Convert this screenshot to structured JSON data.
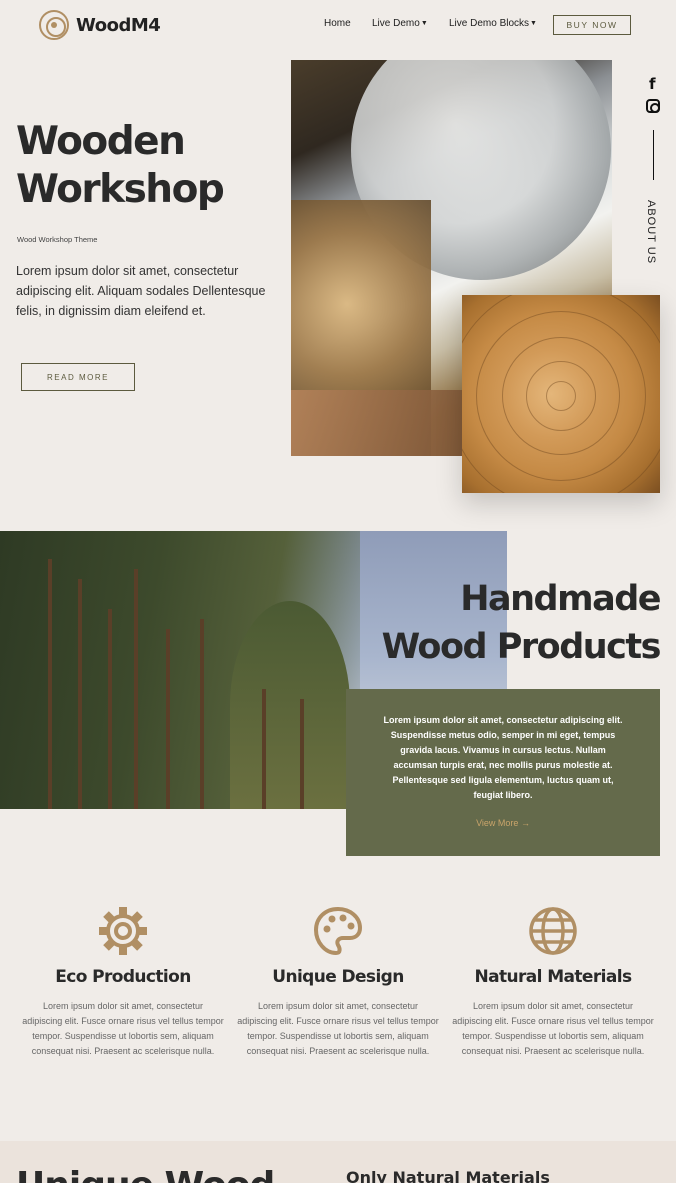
{
  "nav": {
    "logo_text": "WoodM4",
    "home": "Home",
    "live_demo": "Live Demo",
    "live_demo_blocks": "Live Demo Blocks",
    "buy_now": "BUY NOW"
  },
  "hero": {
    "title_line1": "Wooden",
    "title_line2": "Workshop",
    "subtitle": "Wood Workshop Theme",
    "text": "Lorem ipsum dolor sit amet, consectetur adipiscing elit. Aliquam sodales Dellentesque felis, in dignissim diam eleifend et.",
    "button": "READ MORE",
    "side_label": "ABOUT US"
  },
  "section2": {
    "title_line1": "Handmade",
    "title_line2": "Wood Products",
    "text": "Lorem ipsum dolor sit amet, consectetur adipiscing elit. Suspendisse metus odio, semper in mi eget, tempus gravida lacus. Vivamus in cursus lectus. Nullam accumsan turpis erat, nec mollis purus molestie at. Pellentesque sed ligula elementum, luctus quam ut, feugiat libero.",
    "link": "View More"
  },
  "features": [
    {
      "icon": "gear-icon",
      "title": "Eco Production",
      "text": "Lorem ipsum dolor sit amet, consectetur adipiscing elit. Fusce ornare risus vel tellus tempor tempor. Suspendisse ut lobortis sem, aliquam consequat nisi. Praesent ac scelerisque nulla."
    },
    {
      "icon": "palette-icon",
      "title": "Unique Design",
      "text": "Lorem ipsum dolor sit amet, consectetur adipiscing elit. Fusce ornare risus vel tellus tempor tempor. Suspendisse ut lobortis sem, aliquam consequat nisi. Praesent ac scelerisque nulla."
    },
    {
      "icon": "globe-icon",
      "title": "Natural Materials",
      "text": "Lorem ipsum dolor sit amet, consectetur adipiscing elit. Fusce ornare risus vel tellus tempor tempor. Suspendisse ut lobortis sem, aliquam consequat nisi. Praesent ac scelerisque nulla."
    }
  ],
  "bottom": {
    "big_title": "Unique Wood",
    "small_title": "Only Natural Materials"
  },
  "colors": {
    "accent": "#b08f64",
    "green": "#646a4b",
    "background": "#f0ece8"
  }
}
